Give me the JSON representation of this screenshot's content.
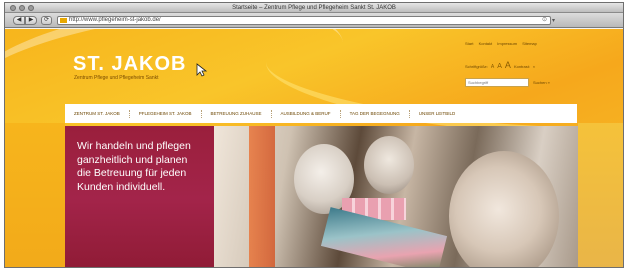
{
  "browser": {
    "window_title": "Startseite – Zentrum Pflege und Pflegeheim Sankt St. JAKOB",
    "back_glyph": "◀",
    "forward_glyph": "▶",
    "reload_glyph": "⟳",
    "url": "http://www.pflegeheim-st-jakob.de/",
    "go_glyph": "⊙",
    "menu_glyph": "▾"
  },
  "site": {
    "logo_title": "ST. JAKOB",
    "logo_subtitle": "Zentrum Pflege und Pflegeheim Sankt",
    "util_links": [
      "Start",
      "Kontakt",
      "Impressum",
      "Sitemap"
    ],
    "font_size_label": "Schriftgröße:",
    "font_size_options": [
      "A",
      "A",
      "A"
    ],
    "contrast_label": "Kontrast:",
    "contrast_glyph": "◐",
    "search_placeholder": "Suchbegriff",
    "search_button": "Suchen »",
    "nav": [
      "ZENTRUM ST. JAKOB",
      "PFLEGEHEIM ST. JAKOB",
      "BETREUUNG ZUHAUSE",
      "AUSBILDUNG & BERUF",
      "TAG DER BEGEGNUNG",
      "UNSER LEITBILD"
    ],
    "teaser_text": "Wir handeln und pflegen ganzheitlich und planen die Betreuung für jeden Kunden individuell."
  },
  "colors": {
    "brand_yellow": "#f7b51c",
    "teaser_red": "#9a1f3c",
    "nav_text": "#6b4500"
  }
}
